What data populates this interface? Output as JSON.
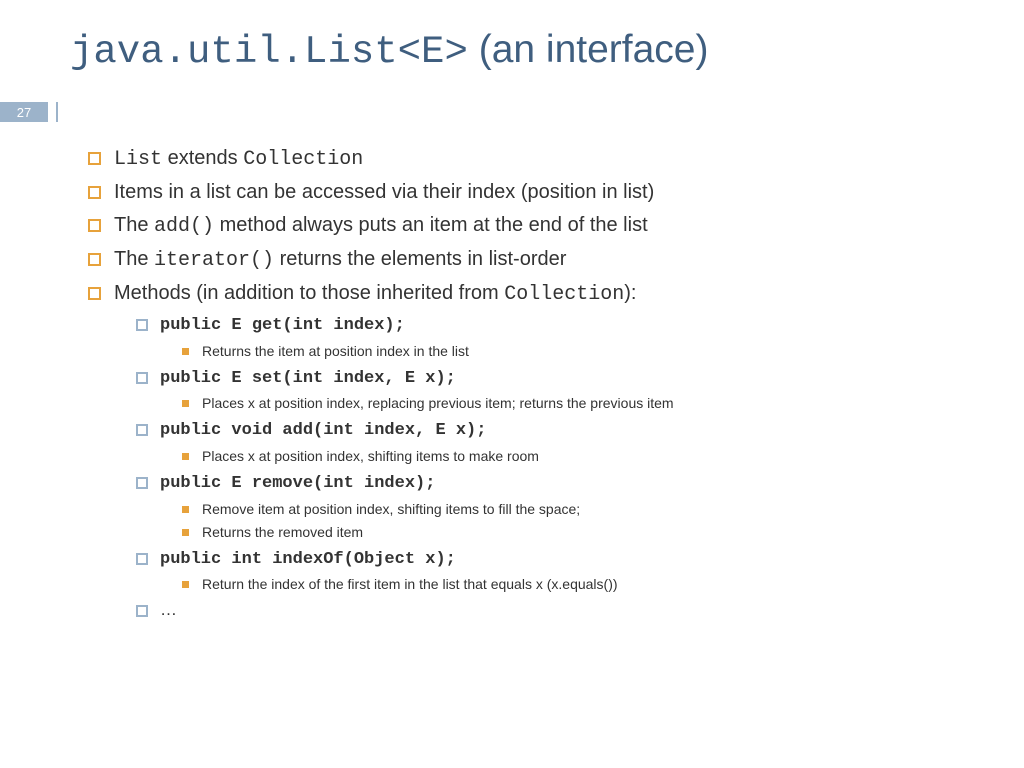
{
  "slide_number": "27",
  "title": {
    "code": "java.util.List<E>",
    "rest": " (an interface)"
  },
  "bullets": [
    {
      "parts": [
        {
          "t": "List",
          "code": true
        },
        {
          "t": " extends "
        },
        {
          "t": "Collection",
          "code": true
        }
      ]
    },
    {
      "parts": [
        {
          "t": "Items in a list can be accessed via their index (position in list)"
        }
      ]
    },
    {
      "parts": [
        {
          "t": "The "
        },
        {
          "t": "add()",
          "code": true
        },
        {
          "t": " method always puts an item at the end of the list"
        }
      ]
    },
    {
      "parts": [
        {
          "t": "The "
        },
        {
          "t": "iterator()",
          "code": true
        },
        {
          "t": " returns the elements in list-order"
        }
      ]
    },
    {
      "parts": [
        {
          "t": "Methods (in addition to those inherited from "
        },
        {
          "t": "Collection",
          "code": true
        },
        {
          "t": "):"
        }
      ],
      "children": [
        {
          "parts": [
            {
              "t": "public E get(int index);",
              "code": true,
              "bold": true
            }
          ],
          "children": [
            {
              "parts": [
                {
                  "t": "Returns the item at position index in the list"
                }
              ]
            }
          ]
        },
        {
          "parts": [
            {
              "t": "public E set(int index, E x);",
              "code": true,
              "bold": true
            }
          ],
          "children": [
            {
              "parts": [
                {
                  "t": "Places x at position index, replacing previous item; returns the previous item"
                }
              ]
            }
          ]
        },
        {
          "parts": [
            {
              "t": "public void add(int index, E x);",
              "code": true,
              "bold": true
            }
          ],
          "children": [
            {
              "parts": [
                {
                  "t": "Places x at position index, shifting items to make room"
                }
              ]
            }
          ]
        },
        {
          "parts": [
            {
              "t": "public E remove(int index);",
              "code": true,
              "bold": true
            }
          ],
          "children": [
            {
              "parts": [
                {
                  "t": "Remove item at position index, shifting items to fill the space;"
                }
              ]
            },
            {
              "parts": [
                {
                  "t": "Returns the removed item"
                }
              ]
            }
          ]
        },
        {
          "parts": [
            {
              "t": "public int indexOf(Object x);",
              "code": true,
              "bold": true
            }
          ],
          "children": [
            {
              "parts": [
                {
                  "t": "Return the index of the first item in the list that equals x (x.equals())"
                }
              ]
            }
          ]
        },
        {
          "parts": [
            {
              "t": "…"
            }
          ]
        }
      ]
    }
  ]
}
